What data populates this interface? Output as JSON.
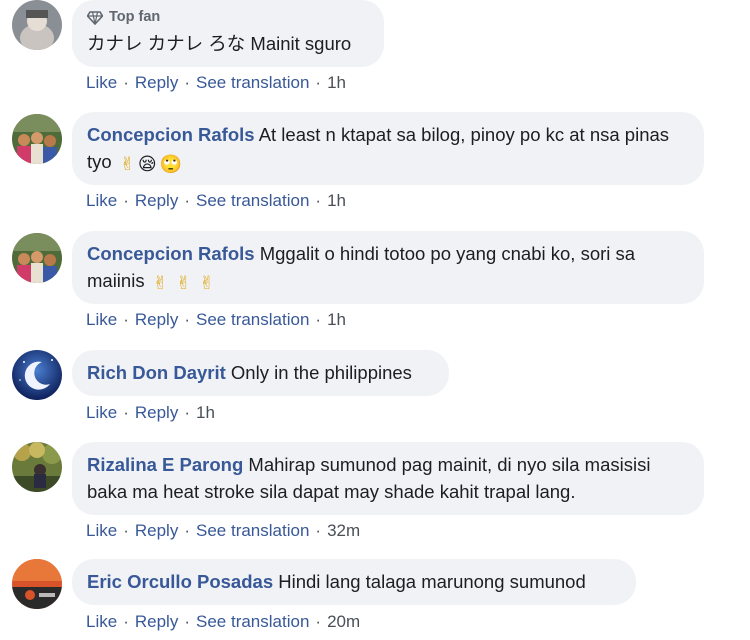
{
  "comments": [
    {
      "badge": "Top fan",
      "text": "カナレ カナレ ろな Mainit sguro",
      "actions": [
        "Like",
        "Reply",
        "See translation"
      ],
      "time": "1h"
    },
    {
      "author": "Concepcion Rafols",
      "text": "At least n ktapat sa bilog, pinoy po kc at nsa pinas tyo",
      "emojis": [
        "✌",
        "😪",
        "🙄"
      ],
      "actions": [
        "Like",
        "Reply",
        "See translation"
      ],
      "time": "1h"
    },
    {
      "author": "Concepcion Rafols",
      "text": "Mggalit o hindi totoo po yang cnabi ko, sori sa maiinis",
      "emojis": [
        "✌",
        "✌",
        "✌"
      ],
      "actions": [
        "Like",
        "Reply",
        "See translation"
      ],
      "time": "1h"
    },
    {
      "author": "Rich Don Dayrit",
      "text": "Only in the philippines",
      "actions": [
        "Like",
        "Reply"
      ],
      "time": "1h"
    },
    {
      "author": "Rizalina E Parong",
      "text": "Mahirap sumunod pag mainit, di nyo sila masisisi baka ma heat stroke sila dapat may shade kahit trapal lang.",
      "actions": [
        "Like",
        "Reply",
        "See translation"
      ],
      "time": "32m"
    },
    {
      "author": "Eric Orcullo Posadas",
      "text": "Hindi lang talaga marunong sumunod",
      "actions": [
        "Like",
        "Reply",
        "See translation"
      ],
      "time": "20m"
    }
  ],
  "separator": "·"
}
